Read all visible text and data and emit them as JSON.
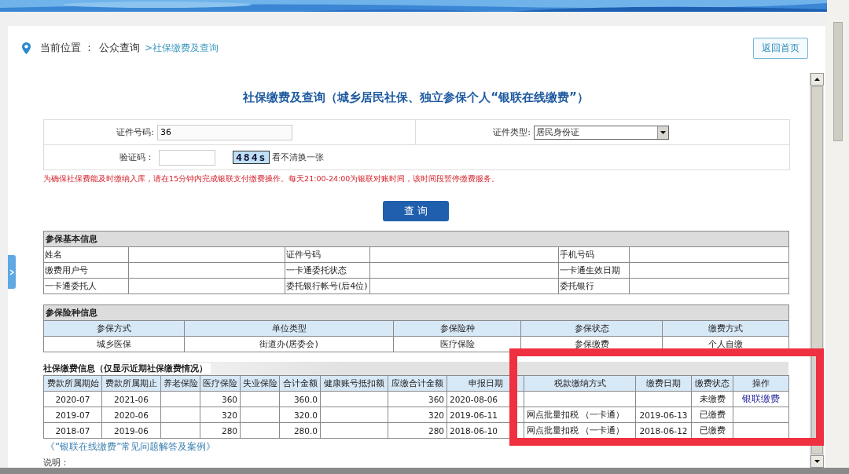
{
  "breadcrumb": {
    "label": "当前位置 ：",
    "path": "公众查询",
    "current": ">社保缴费及查询"
  },
  "home_button": "返回首页",
  "title": "社保缴费及查询（城乡居民社保、独立参保个人“银联在线缴费”）",
  "form": {
    "id_number": {
      "label": "证件号码:",
      "value": "36"
    },
    "id_type": {
      "label": "证件类型:",
      "value": "居民身份证"
    },
    "captcha": {
      "label": "验证码：",
      "code": "484s",
      "refresh": "看不清换一张"
    }
  },
  "notice": "为确保社保费能及时缴纳入库，请在15分钟内完成银联支付缴费操作。每天21:00-24:00为银联对账时间，该时间段暂停缴费服务。",
  "query_button": "查 询",
  "basic_info": {
    "title": "参保基本信息",
    "fields": [
      {
        "label": "姓名"
      },
      {
        "label": "证件号码"
      },
      {
        "label": "手机号码"
      },
      {
        "label": "缴费用户号"
      },
      {
        "label": "一卡通委托状态"
      },
      {
        "label": "一卡通生效日期"
      },
      {
        "label": "一卡通委托人"
      },
      {
        "label": "委托银行帐号(后4位)"
      },
      {
        "label": "委托银行"
      }
    ]
  },
  "insurance_info": {
    "title": "参保险种信息",
    "columns": [
      "参保方式",
      "单位类型",
      "参保险种",
      "参保状态",
      "缴费方式"
    ],
    "rows": [
      [
        "城乡医保",
        "街道办(居委会)",
        "医疗保险",
        "参保缴费",
        "个人自缴"
      ]
    ]
  },
  "payment_info": {
    "title": "社保缴费信息（仅显示近期社保缴费情况）",
    "columns": [
      "费款所属期始",
      "费款所属期止",
      "养老保险",
      "医疗保险",
      "失业保险",
      "合计金额",
      "健康账号抵扣额",
      "应缴合计金额",
      "申报日期",
      "税款缴纳方式",
      "缴费日期",
      "缴费状态",
      "操作"
    ],
    "rows": [
      {
        "period_start": "2020-07",
        "period_end": "2021-06",
        "medical": "360",
        "total": "360.0",
        "payable_total": "360",
        "declared_date": "2020-08-06",
        "status": "未缴费",
        "action": "银联缴费"
      },
      {
        "period_start": "2019-07",
        "period_end": "2020-06",
        "medical": "320",
        "total": "320.0",
        "payable_total": "320",
        "declared_date": "2019-06-11",
        "tax_method": "网点批量扣税 （一卡通）",
        "paid_date": "2019-06-13",
        "status": "已缴费"
      },
      {
        "period_start": "2018-07",
        "period_end": "2019-06",
        "medical": "280",
        "total": "280.0",
        "payable_total": "280",
        "declared_date": "2018-06-10",
        "tax_method": "网点批量扣税 （一卡通）",
        "paid_date": "2018-06-12",
        "status": "已缴费"
      }
    ]
  },
  "faq_link": "《“银联在线缴费”常见问题解答及案例》",
  "note_label": "说明："
}
